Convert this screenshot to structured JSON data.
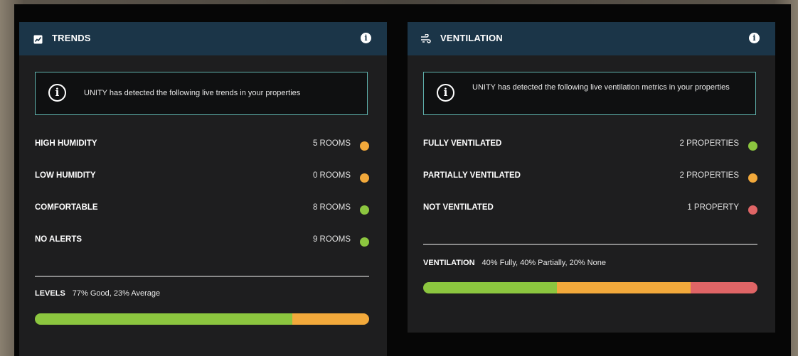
{
  "colors": {
    "green": "#8cc63f",
    "orange": "#f2a93b",
    "red": "#e06566",
    "header_bg": "#1b3548",
    "alert_border": "#5fb2ad"
  },
  "trends": {
    "icon": "chart-icon",
    "title": "TRENDS",
    "info_icon": "info-icon",
    "alert_icon": "info-circle-icon",
    "alert_text": "UNITY has detected the following live trends in your properties",
    "rows": [
      {
        "label": "HIGH HUMIDITY",
        "value": "5 ROOMS",
        "status": "orange"
      },
      {
        "label": "LOW HUMIDITY",
        "value": "0 ROOMS",
        "status": "orange"
      },
      {
        "label": "COMFORTABLE",
        "value": "8 ROOMS",
        "status": "green"
      },
      {
        "label": "NO ALERTS",
        "value": "9 ROOMS",
        "status": "green"
      }
    ],
    "summary_label": "LEVELS",
    "summary_text": "77% Good, 23% Average",
    "bar": [
      {
        "name": "Good",
        "percent": 77,
        "color": "green"
      },
      {
        "name": "Average",
        "percent": 23,
        "color": "orange"
      }
    ]
  },
  "ventilation": {
    "icon": "fan-icon",
    "title": "VENTILATION",
    "info_icon": "info-icon",
    "alert_icon": "info-circle-icon",
    "alert_text": "UNITY has detected the following live ventilation metrics in your properties",
    "rows": [
      {
        "label": "FULLY VENTILATED",
        "value": "2 PROPERTIES",
        "status": "green"
      },
      {
        "label": "PARTIALLY VENTILATED",
        "value": "2 PROPERTIES",
        "status": "orange"
      },
      {
        "label": "NOT VENTILATED",
        "value": "1 PROPERTY",
        "status": "red"
      }
    ],
    "summary_label": "VENTILATION",
    "summary_text": "40% Fully, 40% Partially, 20% None",
    "bar": [
      {
        "name": "Fully",
        "percent": 40,
        "color": "green"
      },
      {
        "name": "Partially",
        "percent": 40,
        "color": "orange"
      },
      {
        "name": "None",
        "percent": 20,
        "color": "red"
      }
    ]
  }
}
